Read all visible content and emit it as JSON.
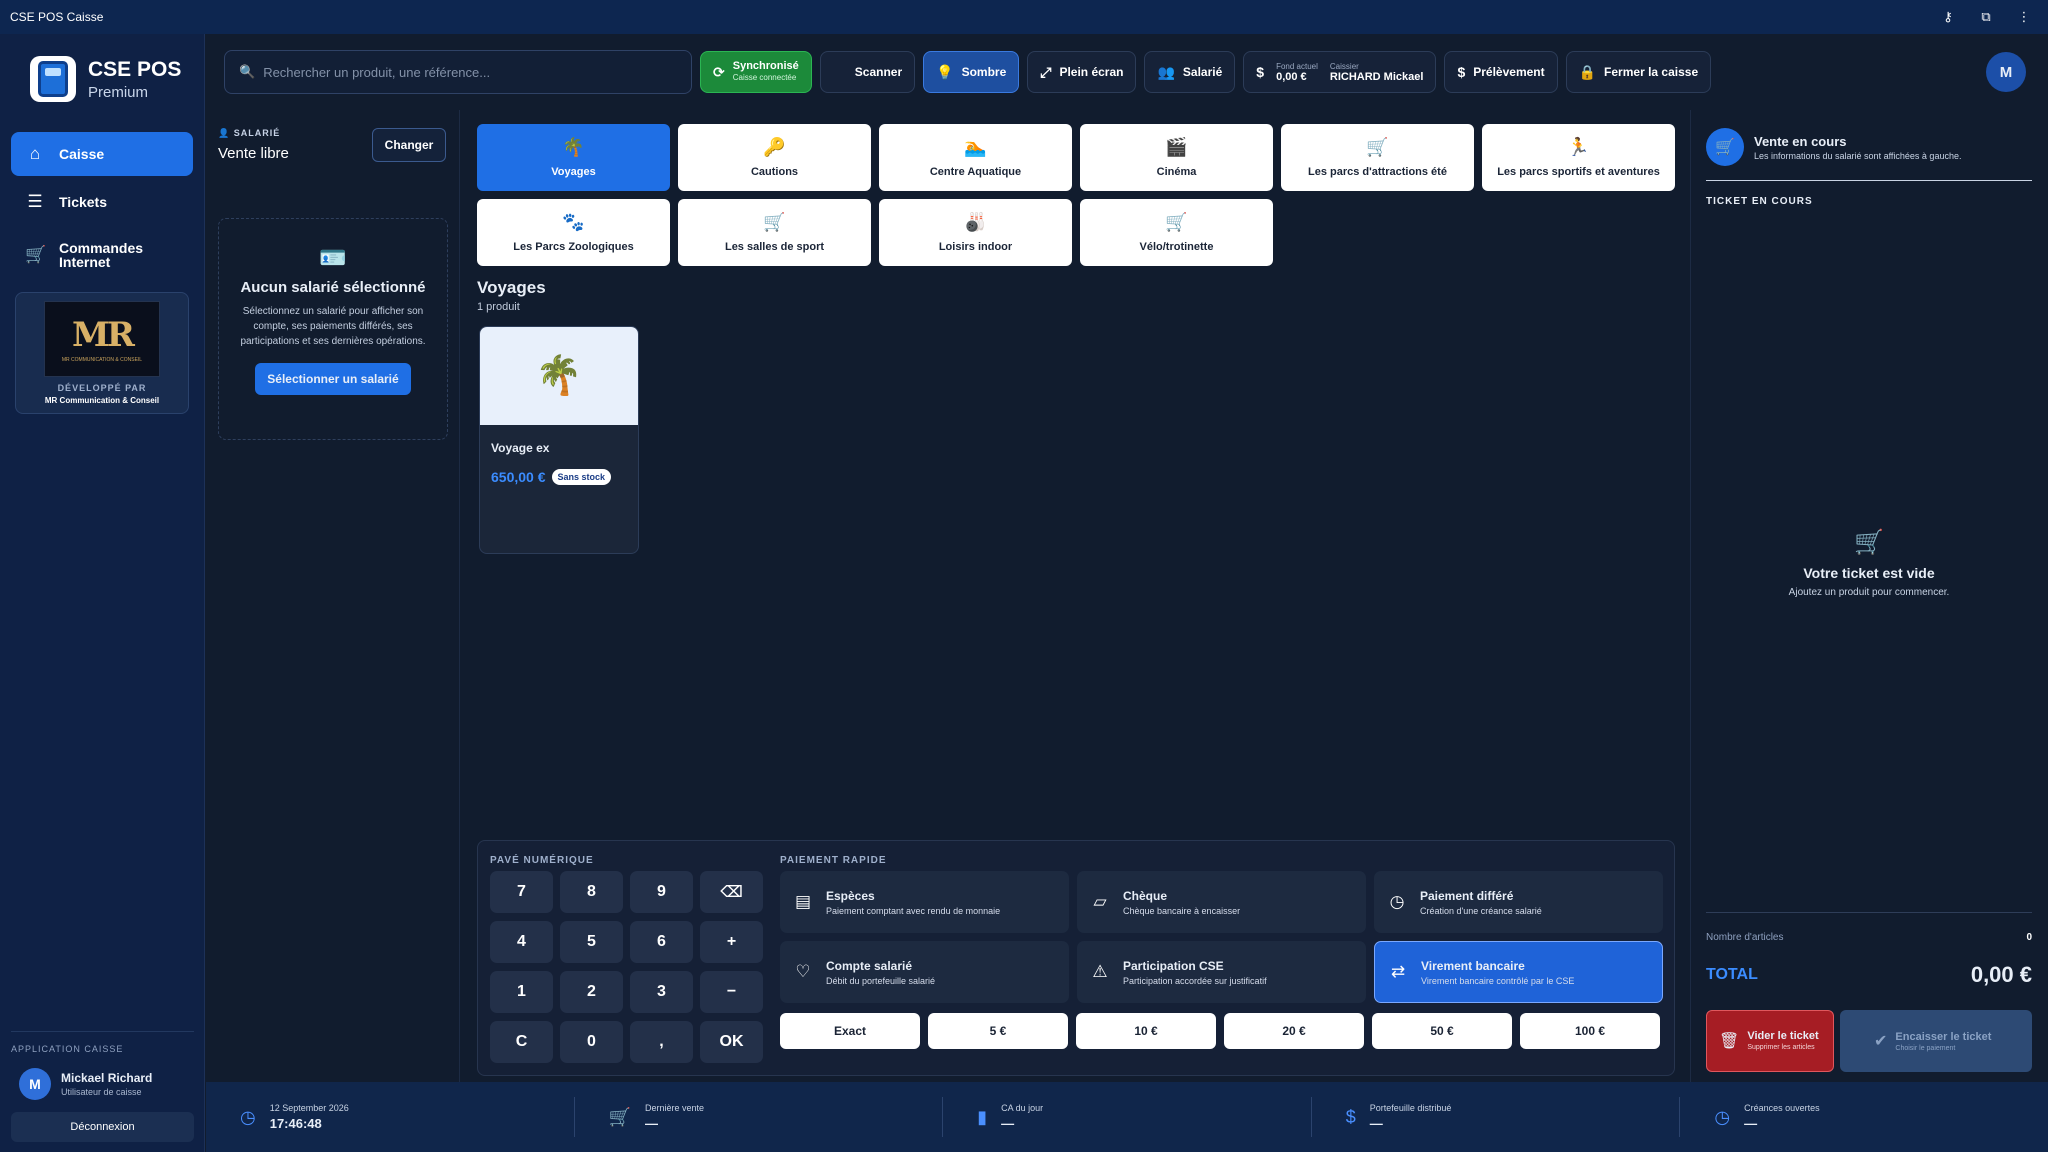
{
  "window": {
    "title": "CSE POS Caisse"
  },
  "brand": {
    "name": "CSE POS",
    "edition": "Premium"
  },
  "nav": [
    {
      "label": "Caisse",
      "icon": "store-icon",
      "active": true
    },
    {
      "label": "Tickets",
      "icon": "tickets-icon",
      "active": false
    },
    {
      "label": "Commandes Internet",
      "icon": "cart-icon",
      "active": false
    }
  ],
  "promo": {
    "logo_text": "MR",
    "logo_sub": "MR COMMUNICATION & CONSEIL",
    "dev_label": "DÉVELOPPÉ PAR",
    "company": "MR Communication & Conseil"
  },
  "sidebar_footer": {
    "section_label": "APPLICATION CAISSE",
    "user_initial": "M",
    "user_name": "Mickael Richard",
    "user_role": "Utilisateur de caisse",
    "logout": "Déconnexion"
  },
  "search": {
    "placeholder": "Rechercher un produit, une référence..."
  },
  "toolbar": {
    "sync": {
      "label": "Synchronisé",
      "sub": "Caisse connectée"
    },
    "scanner": "Scanner",
    "dark": "Sombre",
    "fullscreen": "Plein écran",
    "employee": "Salarié",
    "fund": {
      "label": "Fond actuel",
      "value": "0,00 €",
      "cashier_label": "Caissier",
      "cashier": "RICHARD Mickael"
    },
    "withdrawal": "Prélèvement",
    "close": "Fermer la caisse",
    "avatar": "M"
  },
  "employee": {
    "label": "SALARIÉ",
    "value": "Vente libre",
    "change": "Changer",
    "empty_title": "Aucun salarié sélectionné",
    "empty_desc": "Sélectionnez un salarié pour afficher son compte, ses paiements différés, ses participations et ses dernières opérations.",
    "select_btn": "Sélectionner un salarié"
  },
  "categories": [
    {
      "label": "Voyages",
      "icon": "🌴",
      "active": true
    },
    {
      "label": "Cautions",
      "icon": "🔑",
      "active": false
    },
    {
      "label": "Centre Aquatique",
      "icon": "🏊",
      "active": false
    },
    {
      "label": "Cinéma",
      "icon": "🎬",
      "active": false
    },
    {
      "label": "Les parcs d'attractions été",
      "icon": "🛒",
      "active": false
    },
    {
      "label": "Les parcs sportifs et aventures",
      "icon": "🏃",
      "active": false
    },
    {
      "label": "Les Parcs Zoologiques",
      "icon": "🐾",
      "active": false
    },
    {
      "label": "Les salles de sport",
      "icon": "🛒",
      "active": false
    },
    {
      "label": "Loisirs indoor",
      "icon": "🎳",
      "active": false
    },
    {
      "label": "Vélo/trotinette",
      "icon": "🛒",
      "active": false
    }
  ],
  "section": {
    "title": "Voyages",
    "count": "1 produit"
  },
  "products": [
    {
      "name": "Voyage ex",
      "price": "650,00 €",
      "badge": "Sans stock",
      "icon": "🌴"
    }
  ],
  "keypad": {
    "label": "PAVÉ NUMÉRIQUE",
    "keys": [
      "7",
      "8",
      "9",
      "⌫",
      "4",
      "5",
      "6",
      "+",
      "1",
      "2",
      "3",
      "−",
      "C",
      "0",
      ",",
      "OK"
    ]
  },
  "quick_pay": {
    "label": "PAIEMENT RAPIDE",
    "methods": [
      {
        "title": "Espèces",
        "sub": "Paiement comptant avec rendu de monnaie",
        "icon": "▤",
        "active": false
      },
      {
        "title": "Chèque",
        "sub": "Chèque bancaire à encaisser",
        "icon": "▱",
        "active": false
      },
      {
        "title": "Paiement différé",
        "sub": "Création d'une créance salarié",
        "icon": "◷",
        "active": false
      },
      {
        "title": "Compte salarié",
        "sub": "Débit du portefeuille salarié",
        "icon": "♡",
        "active": false
      },
      {
        "title": "Participation CSE",
        "sub": "Participation accordée sur justificatif",
        "icon": "⚠",
        "active": false
      },
      {
        "title": "Virement bancaire",
        "sub": "Virement bancaire contrôlé par le CSE",
        "icon": "⇄",
        "active": true
      }
    ],
    "amounts": [
      "Exact",
      "5 €",
      "10 €",
      "20 €",
      "50 €",
      "100 €"
    ]
  },
  "ticket": {
    "title": "Vente en cours",
    "subtitle": "Les informations du salarié sont affichées à gauche.",
    "section": "TICKET EN COURS",
    "empty_title": "Votre ticket est vide",
    "empty_sub": "Ajoutez un produit pour commencer.",
    "count_label": "Nombre d'articles",
    "count_value": "0",
    "total_label": "TOTAL",
    "total_value": "0,00 €",
    "clear": {
      "title": "Vider le ticket",
      "sub": "Supprimer les articles"
    },
    "checkout": {
      "title": "Encaisser le ticket",
      "sub": "Choisir le paiement"
    }
  },
  "status": [
    {
      "label": "12 September 2026",
      "value": "17:46:48",
      "icon": "clock-icon"
    },
    {
      "label": "Dernière vente",
      "value": "—",
      "icon": "cart-icon"
    },
    {
      "label": "CA du jour",
      "value": "—",
      "icon": "bar-chart-icon"
    },
    {
      "label": "Portefeuille distribué",
      "value": "—",
      "icon": "dollar-icon"
    },
    {
      "label": "Créances ouvertes",
      "value": "—",
      "icon": "clock-icon"
    }
  ]
}
